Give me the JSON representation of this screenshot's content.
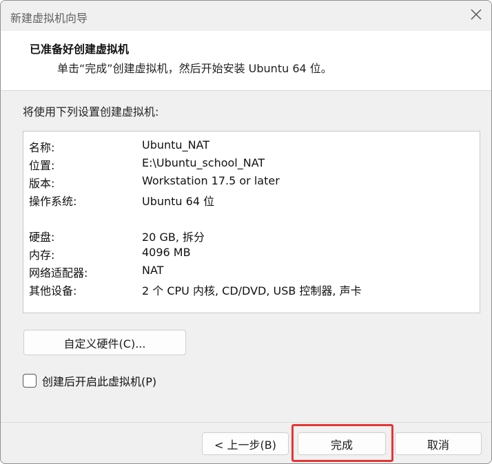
{
  "window": {
    "title": "新建虚拟机向导",
    "close_icon": "close-icon"
  },
  "header": {
    "title": "已准备好创建虚拟机",
    "subtitle": "单击“完成”创建虚拟机，然后开始安装 Ubuntu 64 位。"
  },
  "main": {
    "intro": "将使用下列设置创建虚拟机:",
    "summary": [
      {
        "label": "名称:",
        "value": "Ubuntu_NAT"
      },
      {
        "label": "位置:",
        "value": "E:\\Ubuntu_school_NAT"
      },
      {
        "label": "版本:",
        "value": "Workstation 17.5 or later"
      },
      {
        "label": "操作系统:",
        "value": "Ubuntu 64 位"
      },
      {
        "label": "硬盘:",
        "value": "20 GB, 拆分"
      },
      {
        "label": "内存:",
        "value": "4096 MB"
      },
      {
        "label": "网络适配器:",
        "value": "NAT"
      },
      {
        "label": "其他设备:",
        "value": "2 个 CPU 内核, CD/DVD, USB 控制器, 声卡"
      }
    ],
    "customize_button": "自定义硬件(C)...",
    "power_on_checkbox": {
      "label": "创建后开启此虚拟机(P)",
      "checked": false
    }
  },
  "footer": {
    "back_button": "< 上一步(B)",
    "finish_button": "完成",
    "cancel_button": "取消"
  },
  "colors": {
    "highlight": "#e53535",
    "window_bg": "#f0f0f0",
    "panel_bg": "#ffffff"
  }
}
